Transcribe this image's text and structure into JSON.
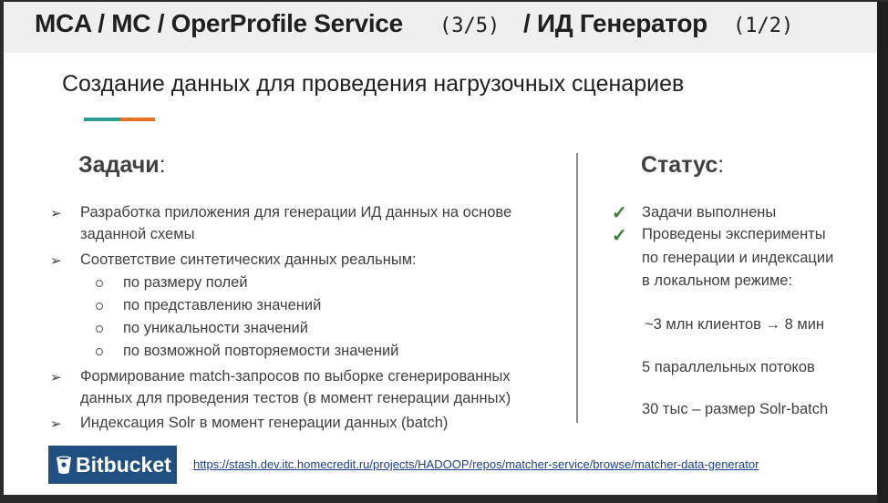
{
  "header": {
    "title_part1": "MCA / MC / OperProfile Service",
    "title_part2": "(3/5)",
    "title_part3": "/ ИД Генератор",
    "title_part4": "(1/2)"
  },
  "subtitle": "Создание данных для проведения нагрузочных сценариев",
  "accent_colors": [
    "#2a9d8f",
    "#e76f24"
  ],
  "tasks": {
    "heading": "Задачи",
    "heading_suffix": ":",
    "lines": [
      "Разработка приложения для генерации ИД данных на основе",
      "заданной схемы",
      "Соответствие синтетических данных реальным:",
      "по размеру полей",
      "по представлению значений",
      "по уникальности значений",
      "по возможной повторяемости значений",
      "Формирование match-запросов по выборке сгенерированных",
      "данных для проведения тестов (в момент генерации данных)",
      "Индексация Solr в момент генерации данных (batch)"
    ]
  },
  "status": {
    "heading": "Статус",
    "heading_suffix": ":",
    "lines": [
      "Задачи выполнены",
      "Проведены эксперименты",
      "по генерации и индексации",
      "в локальном режиме:",
      "~3 млн клиентов → 8 мин",
      "5 параллельных потоков",
      "30 тыс – размер Solr-batch"
    ]
  },
  "footer": {
    "logo_text": "Bitbucket",
    "link": "https://stash.dev.itc.homecredit.ru/projects/HADOOP/repos/matcher-service/browse/matcher-data-generator"
  }
}
